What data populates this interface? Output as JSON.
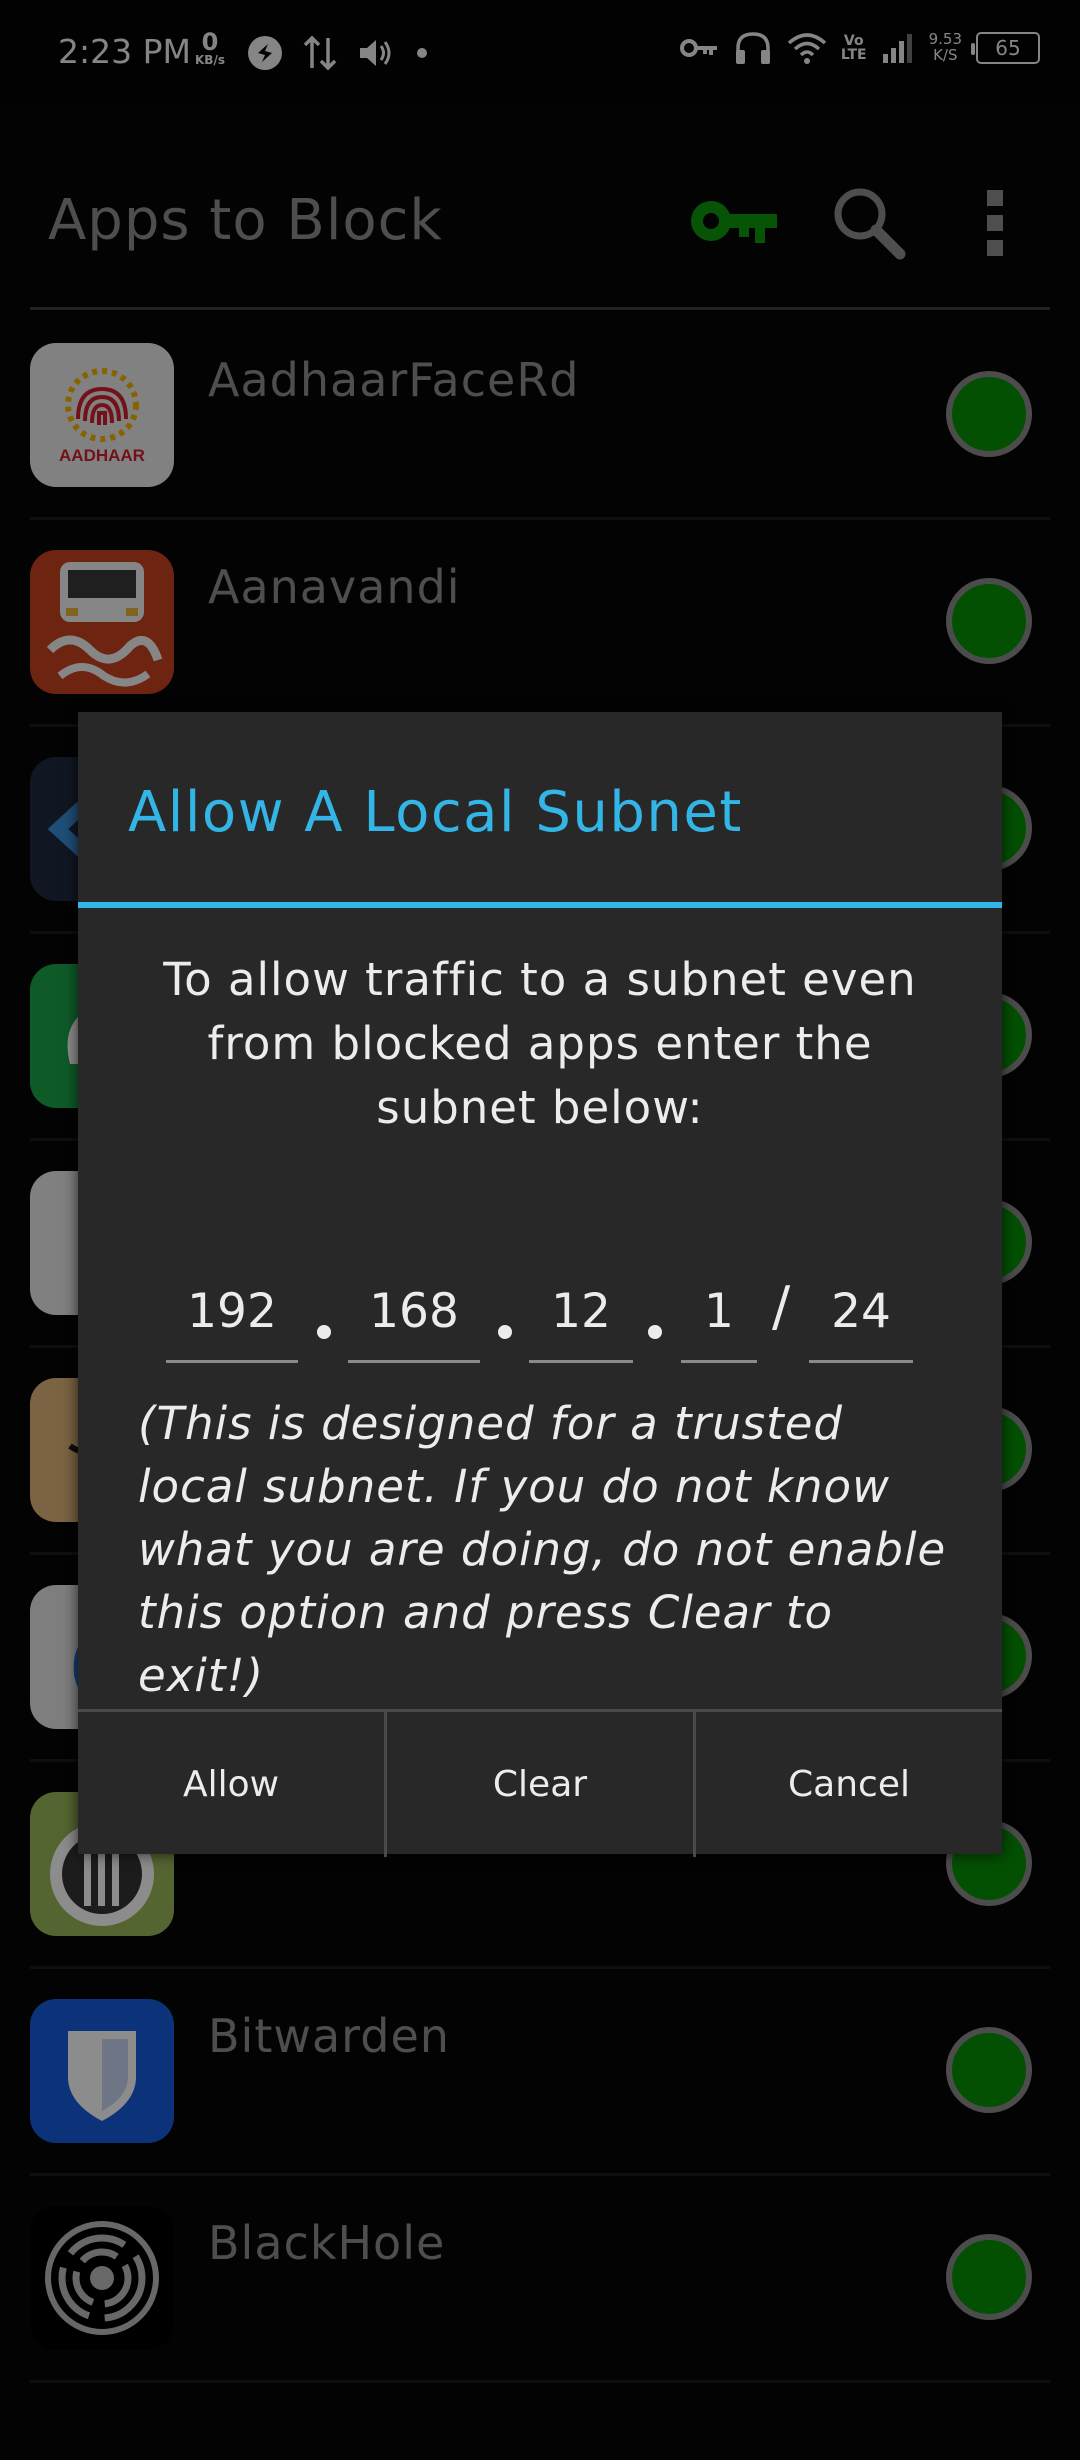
{
  "status_bar": {
    "time": "2:23 PM",
    "net_speed_value": "0",
    "net_speed_unit": "KB/s",
    "vo_label": "Vo",
    "lte_label": "LTE",
    "speed_value": "9.53",
    "speed_unit": "K/S",
    "battery": "65"
  },
  "app_bar": {
    "title": "Apps to Block",
    "key_color": "#0e9a0e",
    "icons": [
      "key-icon",
      "search-icon",
      "more-vert-icon"
    ]
  },
  "apps": [
    {
      "name": "AadhaarFaceRd",
      "icon_label": "AADHAAR",
      "enabled": true
    },
    {
      "name": "Aanavandi",
      "enabled": true
    },
    {
      "name": "",
      "enabled": true
    },
    {
      "name": "",
      "enabled": true
    },
    {
      "name": "",
      "enabled": true
    },
    {
      "name": "",
      "enabled": true
    },
    {
      "name": "",
      "enabled": true
    },
    {
      "name": "",
      "enabled": true
    },
    {
      "name": "Bitwarden",
      "enabled": true
    },
    {
      "name": "BlackHole",
      "enabled": true
    }
  ],
  "dialog": {
    "title": "Allow A Local Subnet",
    "message": "To allow traffic to a subnet even from blocked apps enter the subnet below:",
    "ip": {
      "octet1": "192",
      "octet2": "168",
      "octet3": "12",
      "octet4": "1",
      "prefix": "24"
    },
    "separator_slash": "/",
    "note": "(This is designed for a trusted local subnet. If you do not know what you are doing, do not enable this option and press Clear to exit!)",
    "buttons": {
      "allow": "Allow",
      "clear": "Clear",
      "cancel": "Cancel"
    }
  },
  "colors": {
    "accent": "#33b5e5",
    "toggle_on": "#069206",
    "background": "#060606",
    "dialog_bg": "#282828"
  }
}
